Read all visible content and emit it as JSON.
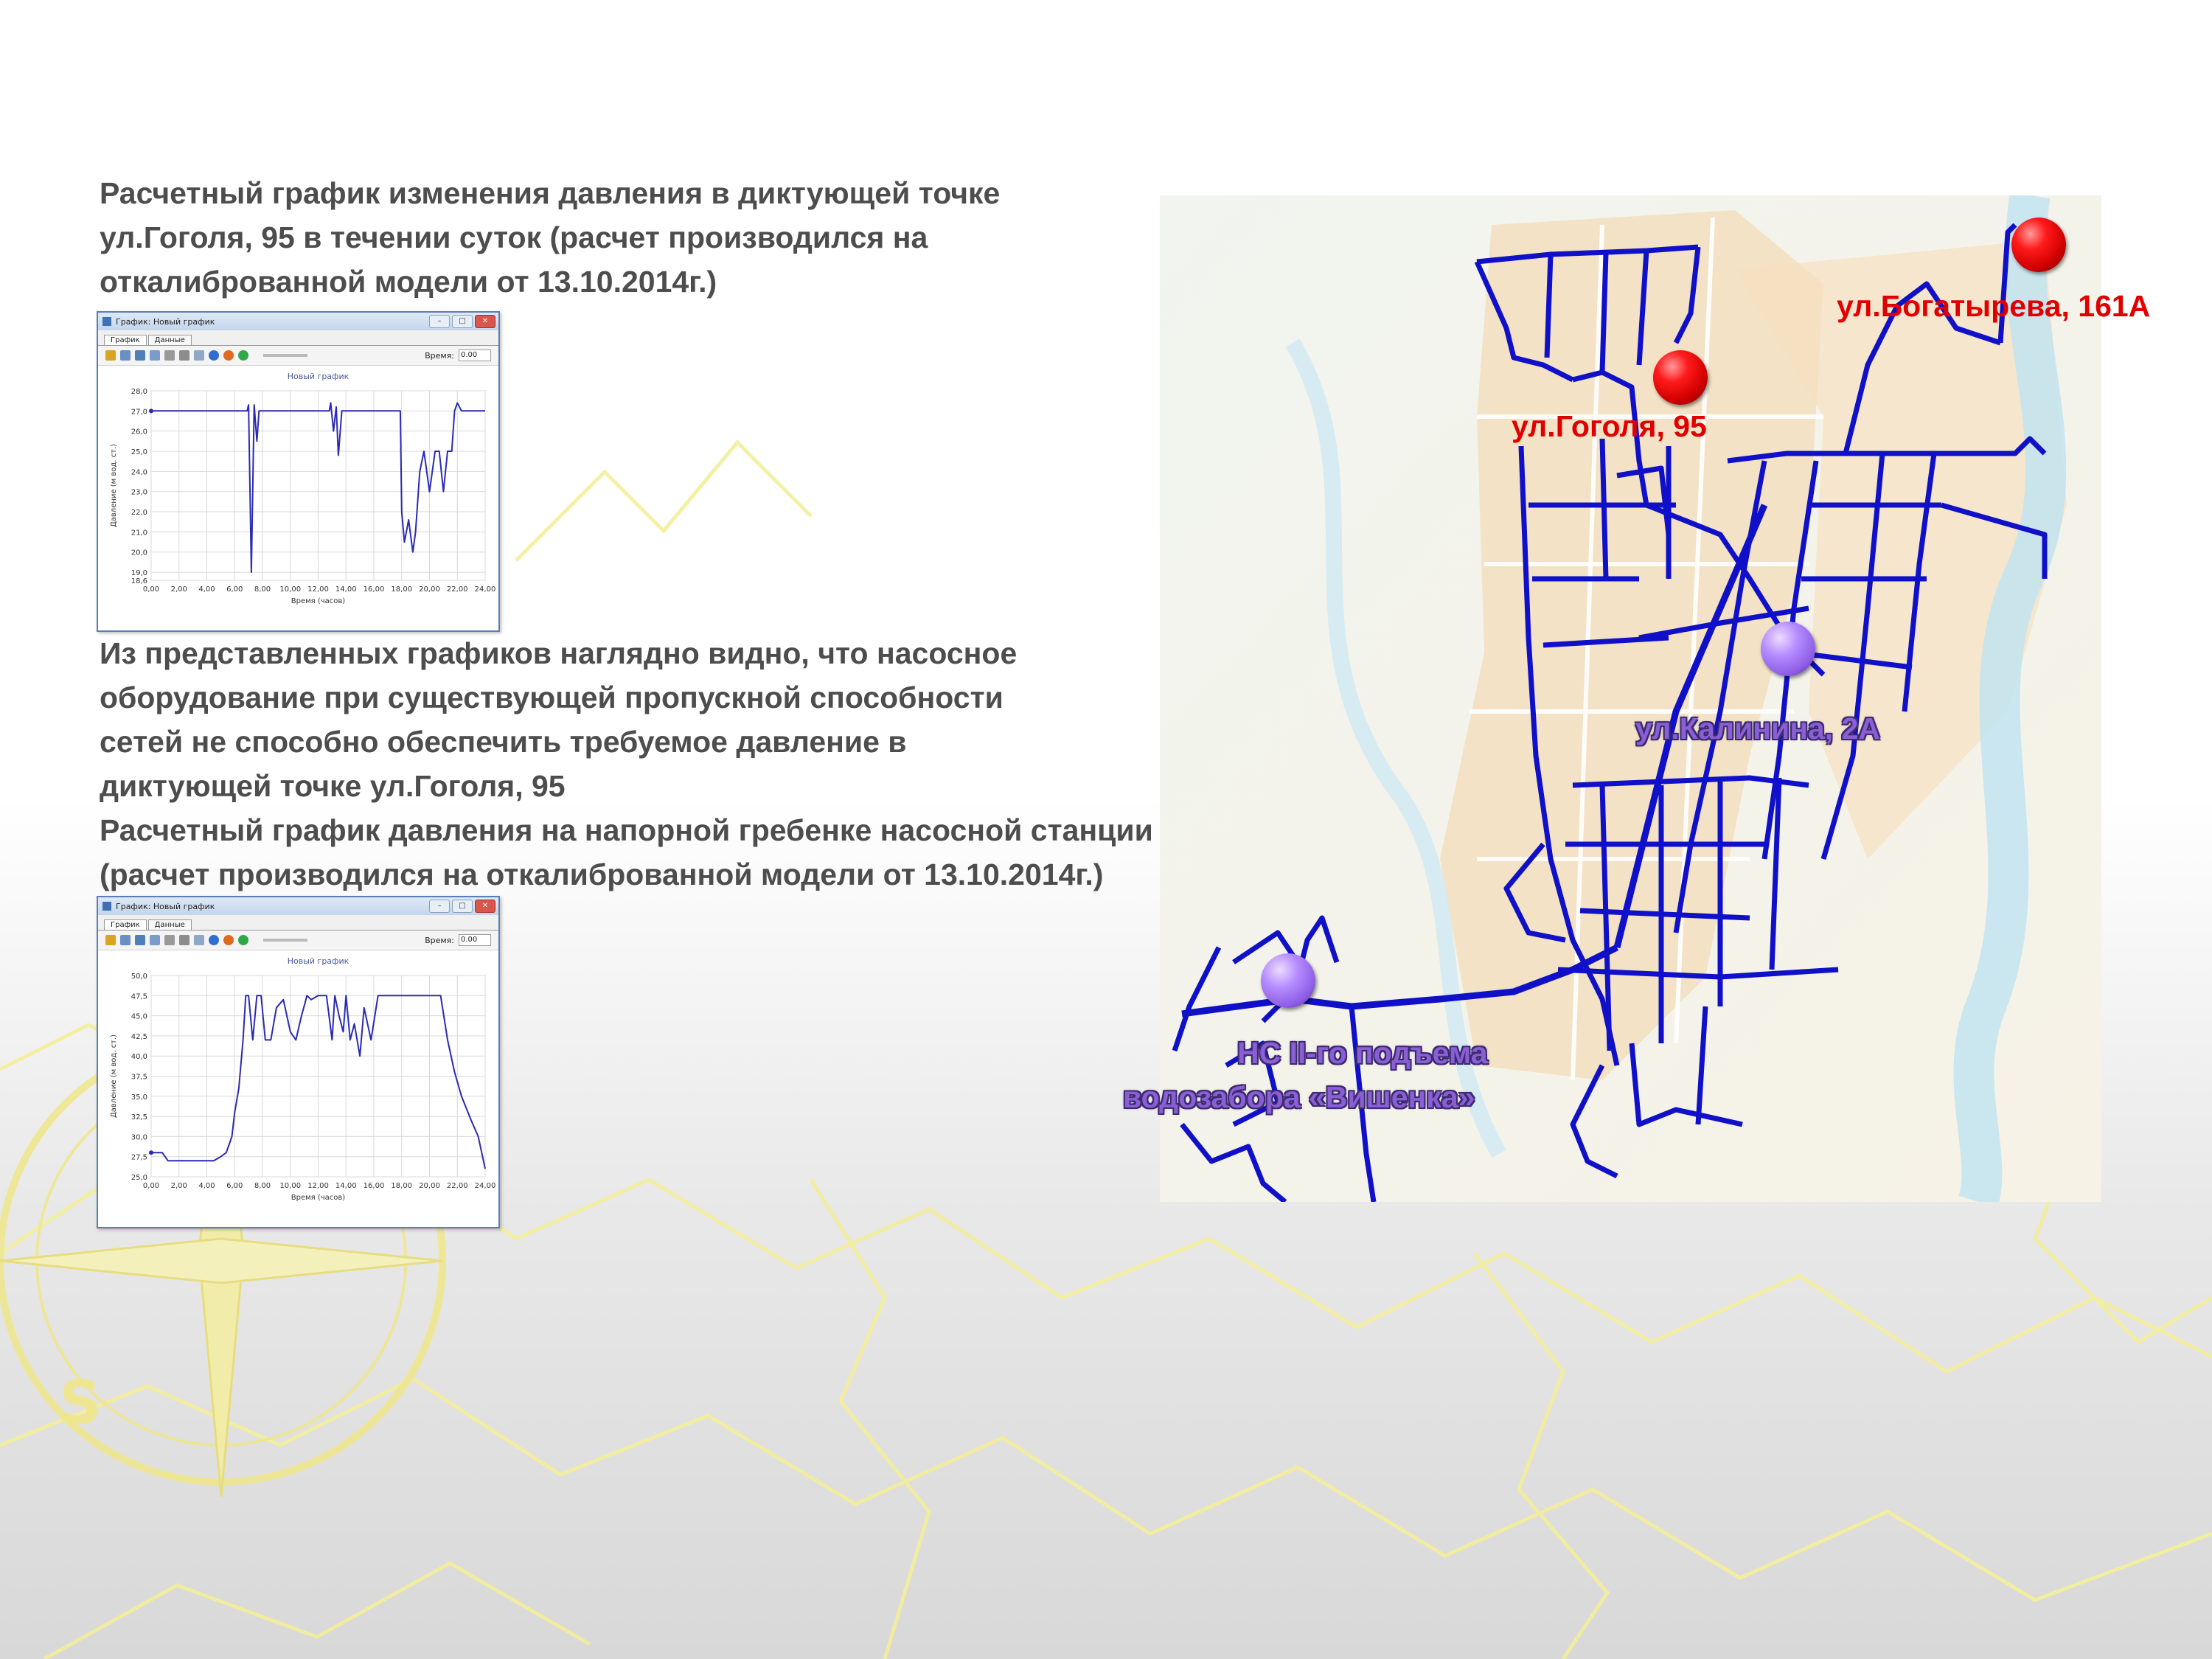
{
  "text": {
    "intro_lines": [
      "Расчетный график изменения давления в диктующей точке",
      "ул.Гоголя, 95 в течении суток (расчет производился на",
      "откалиброванной модели от 13.10.2014г.)"
    ],
    "middle_lines": [
      "Из представленных графиков наглядно видно, что насосное",
      "оборудование при существующей пропускной способности",
      "сетей не способно обеспечить требуемое давление в",
      "диктующей точке ул.Гоголя, 95",
      "Расчетный график давления на напорной гребенке насосной станции",
      "(расчет производился на откалиброванной модели от 13.10.2014г.)"
    ]
  },
  "windows": [
    {
      "title": "График: Новый график",
      "tabs": [
        "График",
        "Данные"
      ],
      "time_label": "Время:",
      "time_value": "0.00",
      "chart_title": "Новый график",
      "ylabel": "Давление (м вод. ст.)",
      "xlabel": "Время (часов)",
      "controls": [
        "–",
        "□",
        "✕"
      ]
    },
    {
      "title": "График: Новый график",
      "tabs": [
        "График",
        "Данные"
      ],
      "time_label": "Время:",
      "time_value": "0.00",
      "chart_title": "Новый график",
      "ylabel": "Давление (м вод. ст.)",
      "xlabel": "Время (часов)",
      "controls": [
        "–",
        "□",
        "✕"
      ]
    }
  ],
  "chart_data": [
    {
      "type": "line",
      "title": "Новый график",
      "xlabel": "Время (часов)",
      "ylabel": "Давление (м вод. ст.)",
      "xlim": [
        0,
        24
      ],
      "ylim": [
        18.6,
        28.0
      ],
      "xticks": [
        "0,00",
        "2,00",
        "4,00",
        "6,00",
        "8,00",
        "10,00",
        "12,00",
        "14,00",
        "16,00",
        "18,00",
        "20,00",
        "22,00",
        "24,00"
      ],
      "yticks": [
        "28,0",
        "27,0",
        "26,0",
        "25,0",
        "24,0",
        "23,0",
        "22,0",
        "21,0",
        "20,0",
        "19,0",
        "18,6"
      ],
      "ytick_values": [
        28,
        27,
        26,
        25,
        24,
        23,
        22,
        21,
        20,
        19,
        18.6
      ],
      "grid": true,
      "series": [
        {
          "x": [
            0,
            6.9,
            7.0,
            7.2,
            7.4,
            7.6,
            7.75,
            8,
            12.8,
            12.9,
            13.1,
            13.3,
            13.45,
            13.7,
            17.9,
            18.0,
            18.2,
            18.5,
            18.8,
            19.0,
            19.3,
            19.6,
            20.0,
            20.4,
            20.7,
            21.0,
            21.3,
            21.6,
            21.8,
            22.0,
            22.3,
            24
          ],
          "y": [
            27.0,
            27.0,
            27.3,
            19.0,
            27.3,
            25.5,
            27.0,
            27.0,
            27.0,
            27.4,
            26.0,
            27.2,
            24.8,
            27.0,
            27.0,
            22.0,
            20.5,
            21.6,
            20.0,
            21.0,
            24.0,
            25.0,
            23.0,
            25.0,
            25.0,
            23.0,
            25.0,
            25.0,
            27.0,
            27.4,
            27.0,
            27.0
          ]
        }
      ]
    },
    {
      "type": "line",
      "title": "Новый график",
      "xlabel": "Время (часов)",
      "ylabel": "Давление (м вод. ст.)",
      "xlim": [
        0,
        24
      ],
      "ylim": [
        25.0,
        50.0
      ],
      "xticks": [
        "0,00",
        "2,00",
        "4,00",
        "6,00",
        "8,00",
        "10,00",
        "12,00",
        "14,00",
        "16,00",
        "18,00",
        "20,00",
        "22,00",
        "24,00"
      ],
      "yticks": [
        "50,0",
        "47,5",
        "45,0",
        "42,5",
        "40,0",
        "37,5",
        "35,0",
        "32,5",
        "30,0",
        "27,5",
        "25,0"
      ],
      "ytick_values": [
        50,
        47.5,
        45,
        42.5,
        40,
        37.5,
        35,
        32.5,
        30,
        27.5,
        25
      ],
      "grid": true,
      "series": [
        {
          "x": [
            0,
            0.8,
            1.2,
            2.0,
            3.5,
            4.5,
            5.0,
            5.4,
            5.8,
            6.0,
            6.3,
            6.6,
            6.8,
            7.0,
            7.3,
            7.6,
            7.9,
            8.2,
            8.6,
            9.0,
            9.5,
            10.0,
            10.4,
            10.8,
            11.2,
            11.5,
            12.0,
            12.3,
            12.6,
            13.0,
            13.2,
            13.5,
            13.8,
            14.0,
            14.3,
            14.6,
            15.0,
            15.3,
            15.8,
            16.3,
            17.0,
            18.0,
            19.0,
            20.0,
            20.8,
            21.3,
            21.8,
            22.3,
            23.0,
            23.5,
            24
          ],
          "y": [
            28.0,
            28.0,
            27.0,
            27.0,
            27.0,
            27.0,
            27.5,
            28.0,
            30.0,
            33.0,
            36.0,
            42.0,
            47.5,
            47.5,
            42.0,
            47.5,
            47.5,
            42.0,
            42.0,
            46.0,
            47.0,
            43.0,
            42.0,
            45.0,
            47.5,
            47.0,
            47.5,
            47.5,
            47.5,
            42.0,
            47.5,
            45.0,
            43.0,
            47.5,
            42.0,
            44.0,
            40.0,
            46.0,
            42.0,
            47.5,
            47.5,
            47.5,
            47.5,
            47.5,
            47.5,
            42.0,
            38.0,
            35.0,
            32.0,
            30.0,
            26.0
          ]
        }
      ]
    }
  ],
  "map": {
    "labels": {
      "gogolya": "ул.Гоголя, 95",
      "bogatyreva": "ул.Богатырева, 161А",
      "kalinina": "ул.Калинина, 2А",
      "ns_line1": "НС II-го подъема",
      "ns_line2": "водозабора «Вишенка»"
    },
    "colors": {
      "network": "#1010c8",
      "critical_point": "#e00000",
      "station": "#8a5fd4"
    }
  }
}
